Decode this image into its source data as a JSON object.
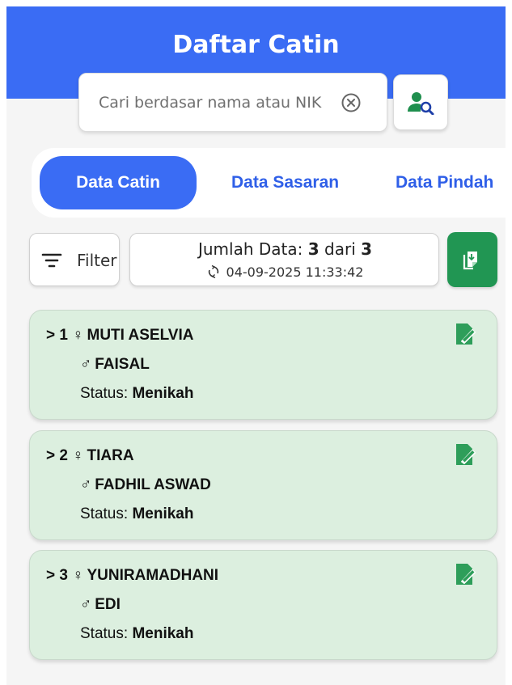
{
  "header": {
    "title": "Daftar Catin"
  },
  "search": {
    "placeholder": "Cari berdasar nama atau NIK"
  },
  "tabs": [
    {
      "label": "Data Catin",
      "active": true
    },
    {
      "label": "Data Sasaran",
      "active": false
    },
    {
      "label": "Data Pindah",
      "active": false
    }
  ],
  "filter": {
    "label": "Filter"
  },
  "summary": {
    "count_label": "Jumlah Data:",
    "shown": "3",
    "separator": "dari",
    "total": "3",
    "last_sync": "04-09-2025 11:33:42"
  },
  "cards": [
    {
      "index": "1",
      "female_name": "MUTI ASELVIA",
      "male_name": "FAISAL",
      "status_label": "Status:",
      "status": "Menikah"
    },
    {
      "index": "2",
      "female_name": "TIARA",
      "male_name": "FADHIL ASWAD",
      "status_label": "Status:",
      "status": "Menikah"
    },
    {
      "index": "3",
      "female_name": "YUNIRAMADHANI",
      "male_name": "EDI",
      "status_label": "Status:",
      "status": "Menikah"
    }
  ],
  "icons": {
    "clear": "clear-circle-icon",
    "user_search": "user-search-icon",
    "filter": "filter-lines-icon",
    "sync": "sync-icon",
    "export": "export-document-icon",
    "edit": "edit-document-icon",
    "female": "female-symbol-icon",
    "male": "male-symbol-icon",
    "expand": "chevron-right-icon"
  },
  "colors": {
    "primary": "#3a6cf4",
    "card_bg": "#dcefdf",
    "export_green": "#219653",
    "edit_green": "#2e9e5a"
  }
}
